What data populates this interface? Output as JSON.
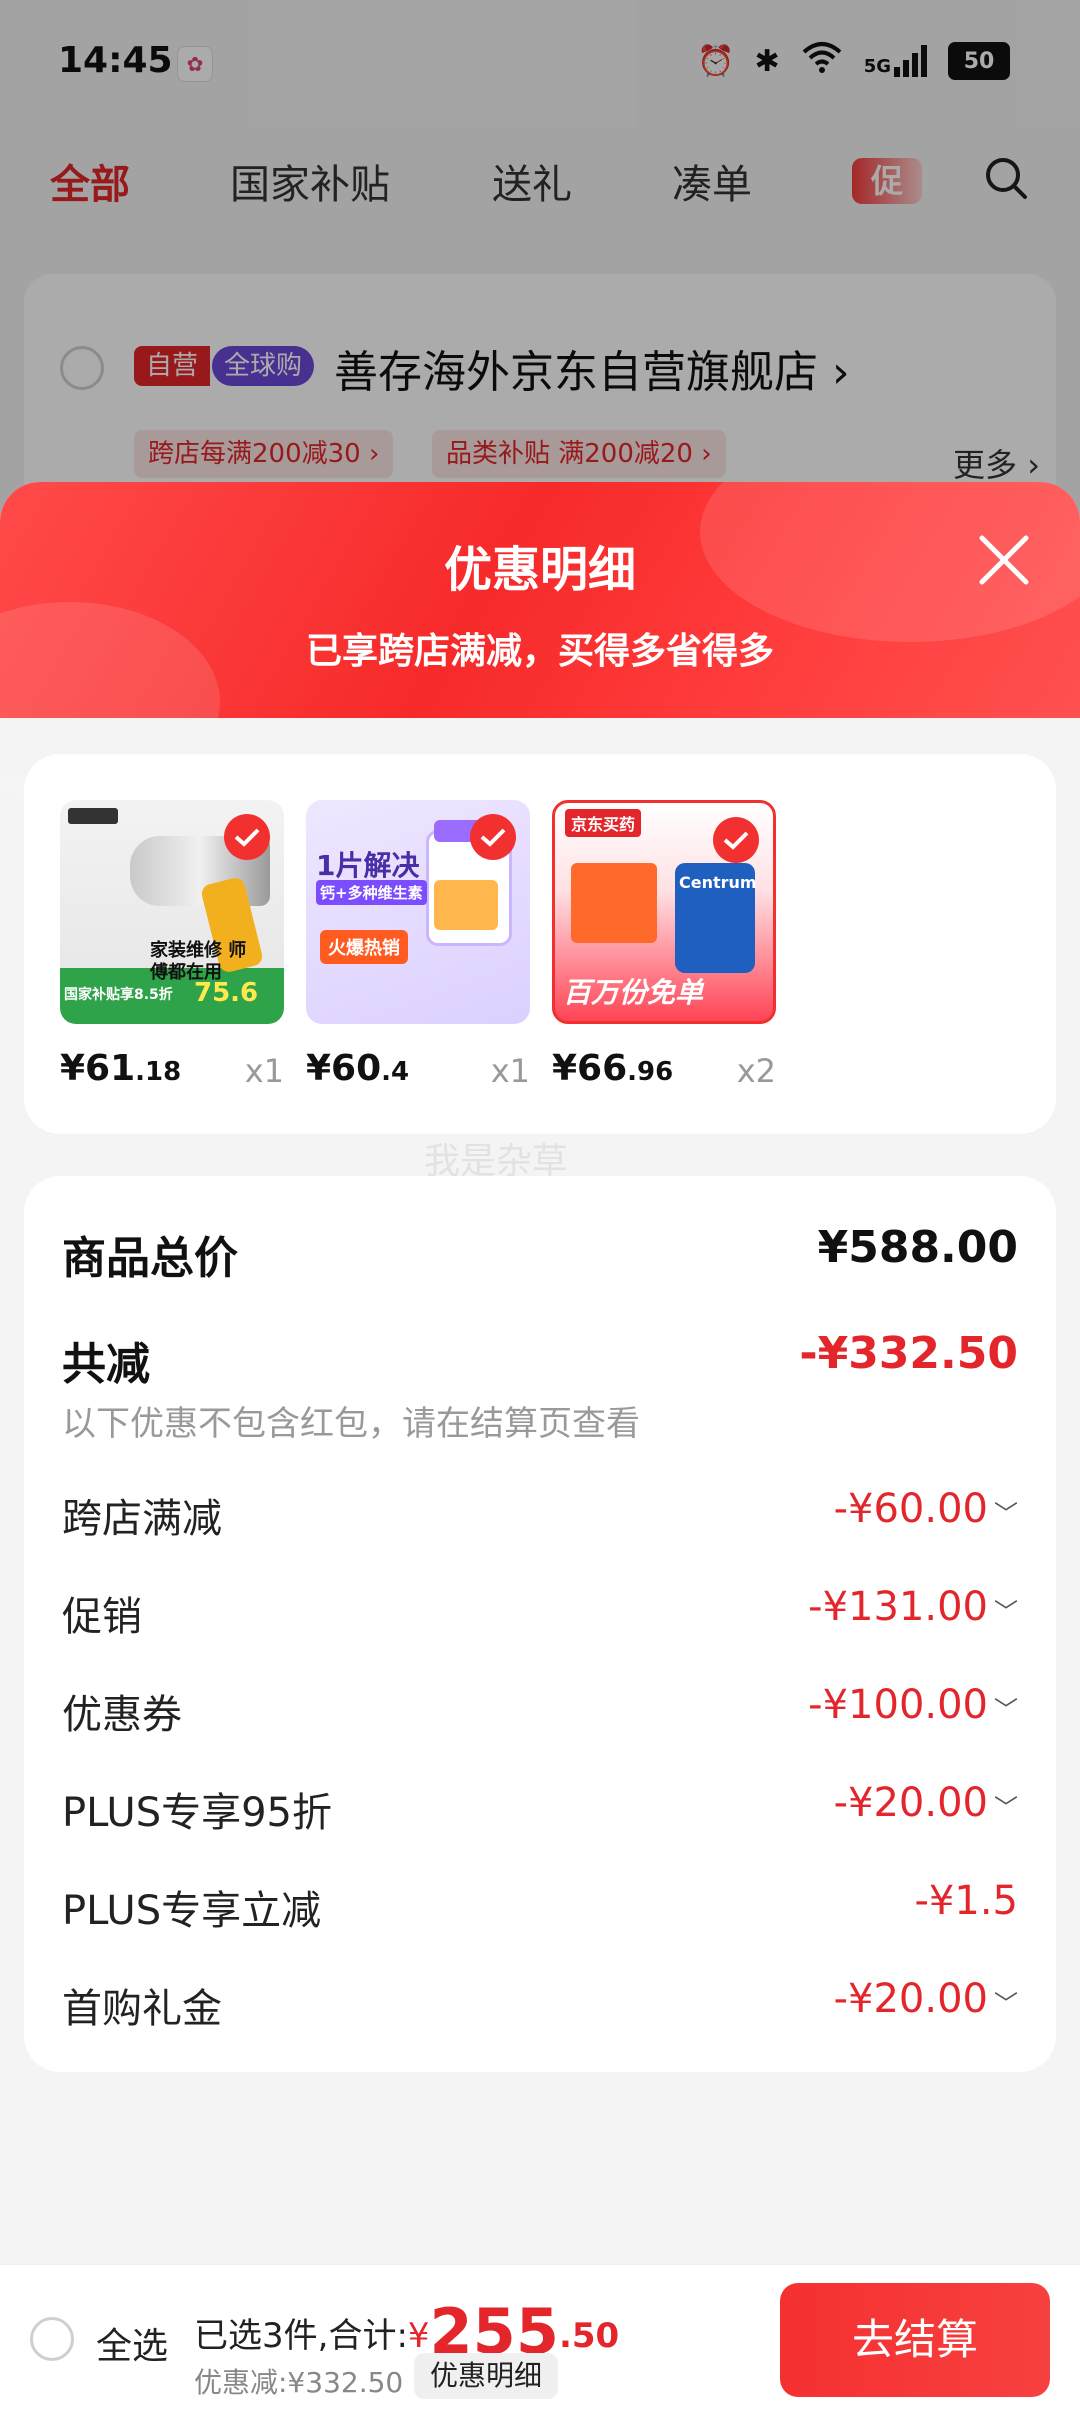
{
  "status_bar": {
    "time": "14:45",
    "battery": "50",
    "network": "5G"
  },
  "tabs": [
    "全部",
    "国家补贴",
    "送礼",
    "凑单"
  ],
  "promo_tab": "促",
  "store": {
    "tag_self": "自营",
    "tag_global": "全球购",
    "name": "善存海外京东自营旗舰店",
    "chips": [
      "跨店每满200减30 ›",
      "品类补贴 满200减20 ›"
    ],
    "more": "更多 ›"
  },
  "sheet": {
    "title": "优惠明细",
    "subtitle": "已享跨店满减，买得多省得多"
  },
  "products": [
    {
      "price_int": "¥61",
      "price_dec": ".18",
      "qty": "x1",
      "thumb_text": "家装维修 师傅都在用",
      "thumb_price": "75.6",
      "thumb_label": "国家补贴享8.5折"
    },
    {
      "price_int": "¥60",
      "price_dec": ".4",
      "qty": "x1",
      "thumb_text": "1片解决",
      "thumb_sub": "钙+多种维生素",
      "thumb_label": "火爆热销"
    },
    {
      "price_int": "¥66",
      "price_dec": ".96",
      "qty": "x2",
      "thumb_text": "百万份免单",
      "thumb_brand": "京东买药",
      "thumb_product": "Centrum"
    }
  ],
  "watermark": "我是杂草",
  "summary": {
    "total_label": "商品总价",
    "total_value": "¥588.00",
    "reduce_label": "共减",
    "reduce_value": "-¥332.50",
    "note": "以下优惠不包含红包，请在结算页查看",
    "items": [
      {
        "label": "跨店满减",
        "value": "-¥60.00"
      },
      {
        "label": "促销",
        "value": "-¥131.00"
      },
      {
        "label": "优惠券",
        "value": "-¥100.00"
      },
      {
        "label": "PLUS专享95折",
        "value": "-¥20.00"
      },
      {
        "label": "PLUS专享立减",
        "value": "-¥1.5"
      },
      {
        "label": "首购礼金",
        "value": "-¥20.00"
      }
    ]
  },
  "bottom": {
    "select_all": "全选",
    "selected_text": "已选3件,合计:",
    "currency": "¥",
    "total_int": "255",
    "total_dec": ".50",
    "discount": "优惠减:¥332.50",
    "detail_button": "优惠明细",
    "checkout": "去结算"
  },
  "colors": {
    "accent": "#e3262b",
    "global_tag": "#6b48d6"
  }
}
